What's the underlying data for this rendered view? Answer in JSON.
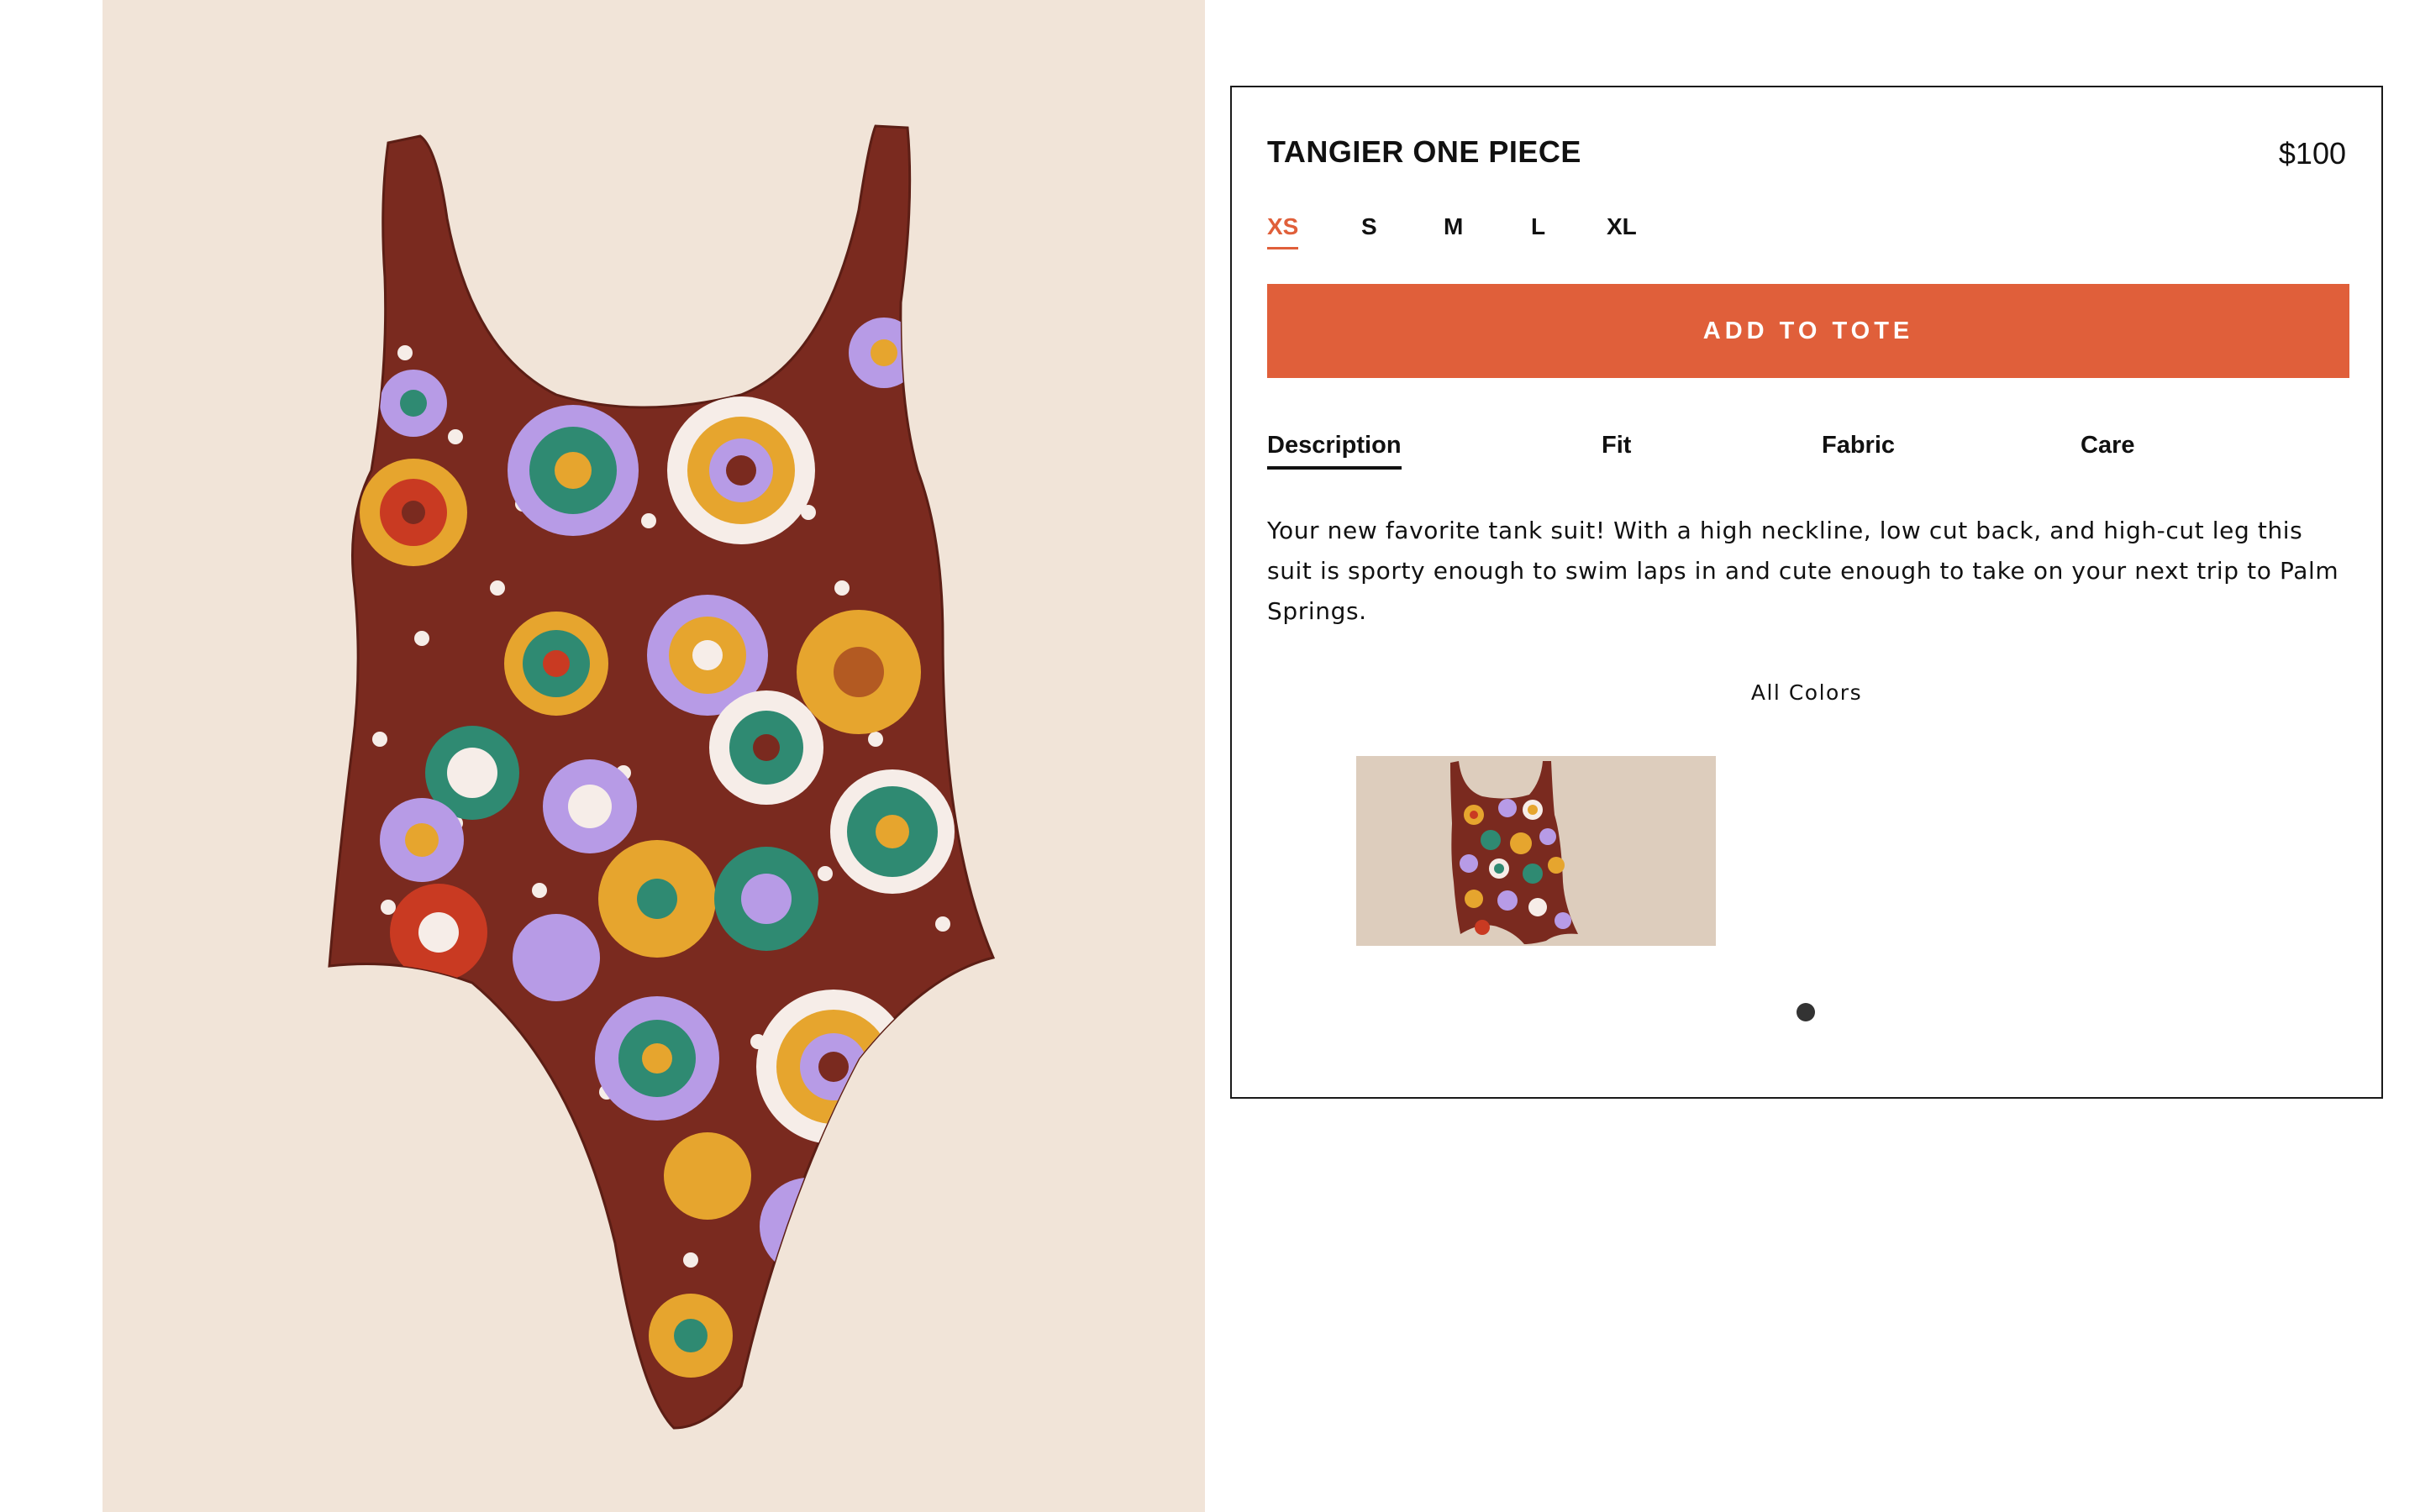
{
  "product": {
    "title": "TANGIER ONE PIECE",
    "price": "$100",
    "image_icon": "swimsuit-floral-image"
  },
  "sizes": [
    {
      "label": "XS",
      "selected": true
    },
    {
      "label": "S",
      "selected": false
    },
    {
      "label": "M",
      "selected": false
    },
    {
      "label": "L",
      "selected": false
    },
    {
      "label": "XL",
      "selected": false
    }
  ],
  "cta": {
    "label": "ADD TO TOTE"
  },
  "tabs": [
    {
      "label": "Description",
      "active": true
    },
    {
      "label": "Fit",
      "active": false
    },
    {
      "label": "Fabric",
      "active": false
    },
    {
      "label": "Care",
      "active": false
    }
  ],
  "description": {
    "text": "Your new favorite tank suit! With a high neckline, low cut back, and high-cut leg this suit is sporty enough to swim laps in and cute enough to take on your next trip to Palm Springs."
  },
  "colors": {
    "heading": "All Colors",
    "swatches": [
      {
        "name": "floral-brown-swatch",
        "selected": true
      }
    ],
    "carousel_pages": 1,
    "current_page": 1
  },
  "theme": {
    "accent": "#e05f3a",
    "panel_bg": "#f1e4d8",
    "suit_base": "#7a2a1f",
    "flower_purple": "#b79be6",
    "flower_yellow": "#e6a52e",
    "flower_green": "#2f8a72",
    "flower_red": "#c93a22"
  }
}
